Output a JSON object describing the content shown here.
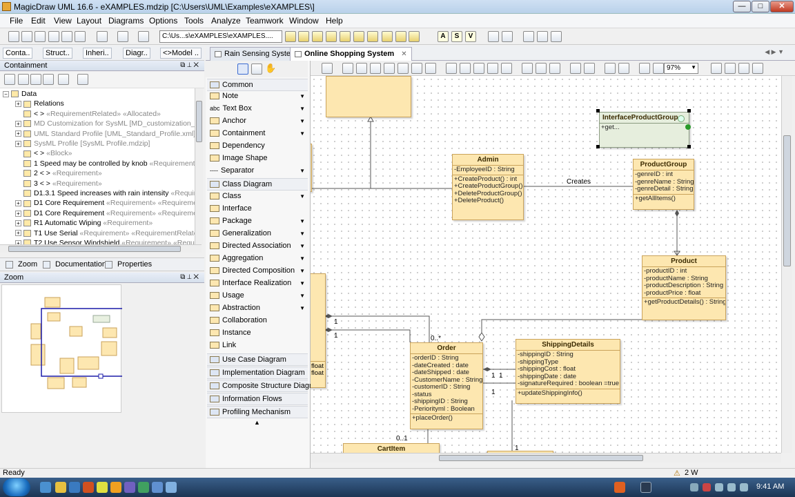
{
  "window": {
    "title": "MagicDraw UML 16.6 - eXAMPLES.mdzip [C:\\Users\\UML\\Examples\\eXAMPLES\\]",
    "minimize": "—",
    "maximize": "□",
    "close": "✕"
  },
  "menu": [
    "File",
    "Edit",
    "View",
    "Layout",
    "Diagrams",
    "Options",
    "Tools",
    "Analyze",
    "Teamwork",
    "Window",
    "Help"
  ],
  "toolbar": {
    "path_combo": "C:\\Us...s\\eXAMPLES\\eXAMPLES....",
    "letters": [
      "A",
      "S",
      "V"
    ]
  },
  "browser_tabs": [
    "Conta..",
    "Struct..",
    "Inheri..",
    "Diagr..",
    "<>Model .."
  ],
  "containment": {
    "header": "Containment",
    "tree": [
      {
        "text": "Data",
        "level": 0,
        "exp": "−"
      },
      {
        "text": "Relations",
        "level": 1,
        "exp": "+"
      },
      {
        "text": "< > ",
        "gray": "«RequirementRelated» «Allocated»",
        "level": 1
      },
      {
        "text": "",
        "gray": "MD Customization for SysML [MD_customization_for",
        "level": 1,
        "exp": "+"
      },
      {
        "text": "",
        "gray": "UML Standard Profile [UML_Standard_Profile.xml]",
        "level": 1,
        "exp": "+"
      },
      {
        "text": "",
        "gray": "SysML Profile [SysML Profile.mdzip]",
        "level": 1,
        "exp": "+"
      },
      {
        "text": "< > ",
        "gray": "«Block»",
        "level": 1
      },
      {
        "text": "1 Speed may be controlled by knob ",
        "gray": "«Requirement»",
        "level": 1
      },
      {
        "text": "2 < > ",
        "gray": "«Requirement»",
        "level": 1
      },
      {
        "text": "3 < > ",
        "gray": "«Requirement»",
        "level": 1
      },
      {
        "text": "D1.3.1 Speed increases with rain intensity ",
        "gray": "«Require",
        "level": 1
      },
      {
        "text": "D1 Core Requirement ",
        "gray": "«Requirement» «Requirement",
        "level": 1,
        "exp": "+"
      },
      {
        "text": "D1 Core Requirement ",
        "gray": "«Requirement» «Requirement",
        "level": 1,
        "exp": "+"
      },
      {
        "text": "R1 Automatic Wiping ",
        "gray": "«Requirement»",
        "level": 1,
        "exp": "+"
      },
      {
        "text": "T1 Use Serial ",
        "gray": "«Requirement» «RequirementRelated»",
        "level": 1,
        "exp": "+"
      },
      {
        "text": "T2 Use Sensor Windshield ",
        "gray": "«Requirement» «Require",
        "level": 1,
        "exp": "+"
      }
    ]
  },
  "bottom_tabs": [
    "Zoom",
    "Documentation",
    "Properties"
  ],
  "zoom_header": "Zoom",
  "palette": [
    {
      "label": "Common",
      "group": true
    },
    {
      "label": "Note",
      "arrow": true
    },
    {
      "label": "Text Box",
      "prefix": "abc",
      "arrow": true
    },
    {
      "label": "Anchor",
      "arrow": true
    },
    {
      "label": "Containment",
      "arrow": true
    },
    {
      "label": "Dependency"
    },
    {
      "label": "Image Shape"
    },
    {
      "label": "Separator",
      "prefix": "----",
      "arrow": true
    },
    {
      "label": "Class Diagram",
      "group": true
    },
    {
      "label": "Class",
      "arrow": true
    },
    {
      "label": "Interface"
    },
    {
      "label": "Package",
      "arrow": true
    },
    {
      "label": "Generalization",
      "arrow": true
    },
    {
      "label": "Directed Association",
      "arrow": true
    },
    {
      "label": "Aggregation",
      "arrow": true
    },
    {
      "label": "Directed Composition",
      "arrow": true
    },
    {
      "label": "Interface Realization",
      "arrow": true
    },
    {
      "label": "Usage",
      "arrow": true
    },
    {
      "label": "Abstraction",
      "arrow": true
    },
    {
      "label": "Collaboration"
    },
    {
      "label": "Instance"
    },
    {
      "label": "Link"
    },
    {
      "label": "Use Case Diagram",
      "group": true
    },
    {
      "label": "Implementation Diagram",
      "group": true
    },
    {
      "label": "Composite Structure Diagr...",
      "group": true
    },
    {
      "label": "Information Flows",
      "group": true
    },
    {
      "label": "Profiling Mechanism",
      "group": true
    }
  ],
  "doc_tabs": [
    {
      "label": "Rain Sensing System",
      "active": false
    },
    {
      "label": "Online Shopping System",
      "active": true,
      "close": "✕"
    }
  ],
  "zoom_level": "97%",
  "classes": {
    "interface_product_group": {
      "name": "InterfaceProductGroup",
      "ops": [
        "+get..."
      ]
    },
    "admin": {
      "name": "Admin",
      "attrs": [
        "-EmployeeID : String"
      ],
      "ops": [
        "+CreateProduct() : int",
        "+CreateProductGroup()",
        "+DeleteProductGroup()",
        "+DeleteProduct()"
      ]
    },
    "product_group": {
      "name": "ProductGroup",
      "attrs": [
        "-genreID : int",
        "-genreName : String",
        "-genreDetail : String"
      ],
      "ops": [
        "+getAllItems()"
      ]
    },
    "product": {
      "name": "Product",
      "attrs": [
        "-productID : int",
        "-productName : String",
        "-productDescription : String",
        "-productPrice : float"
      ],
      "ops": [
        "+getProductDetails() : String"
      ]
    },
    "order": {
      "name": "Order",
      "attrs": [
        "-orderID : String",
        "-dateCreated : date",
        "-dateShipped : date",
        "-CustomerName : String",
        "-customerID : String",
        "-status",
        "-shippingID : String",
        "-Periorityml : Boolean"
      ],
      "ops": [
        "+placeOrder()"
      ]
    },
    "shipping": {
      "name": "ShippingDetails",
      "attrs": [
        "-shippingID : String",
        "-shippingType",
        "-shippingCost : float",
        "-shippingDate : date",
        "-signatureRequired : boolean =true"
      ],
      "ops": [
        "+updateShippingInfo()"
      ]
    },
    "cart_item": {
      "name": "CartItem"
    },
    "left_partial": {
      "attrs": [
        "float",
        "float"
      ]
    }
  },
  "labels": {
    "creates": "Creates",
    "m1a": "1",
    "m1b": "1",
    "m05": "0..*",
    "m11a": "1",
    "m11b": "1",
    "m1c": "1",
    "m01": "0..1",
    "m1d": "1",
    "lp_t": "t",
    "lp_paren": ")"
  },
  "status": {
    "text": "Ready",
    "warn": "2 W"
  },
  "clock": "9:41 AM"
}
